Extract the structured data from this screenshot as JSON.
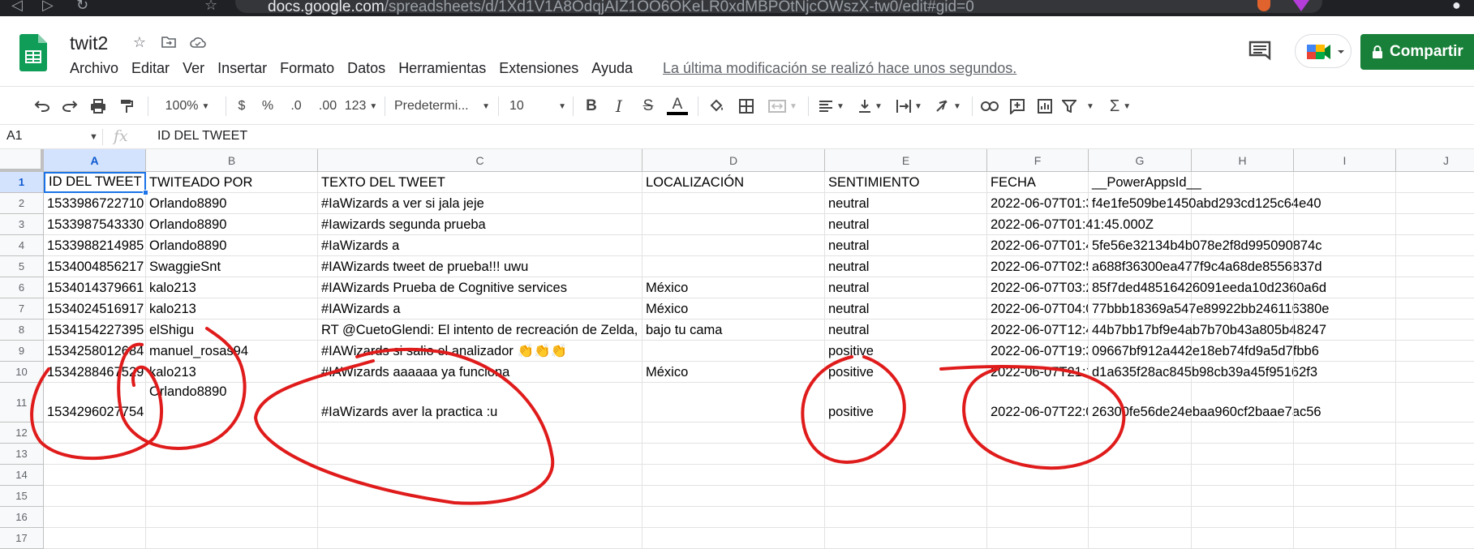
{
  "browser": {
    "url_host": "docs.google.com",
    "url_path": "/spreadsheets/d/1Xd1V1A8OdqjAIZ1OO6OKeLR0xdMBPOtNjcOWszX-tw0/edit#gid=0"
  },
  "doc": {
    "title": "twit2",
    "last_modified": "La última modificación se realizó hace unos segundos."
  },
  "menu": [
    "Archivo",
    "Editar",
    "Ver",
    "Insertar",
    "Formato",
    "Datos",
    "Herramientas",
    "Extensiones",
    "Ayuda"
  ],
  "share_label": "Compartir",
  "toolbar": {
    "zoom": "100%",
    "currency": "$",
    "percent": "%",
    "dec_decrease": ".0",
    "dec_increase": ".00",
    "more_formats": "123",
    "font": "Predetermi...",
    "font_size": "10",
    "bold": "B",
    "italic": "I",
    "strike": "S",
    "text_color": "A"
  },
  "formula_bar": {
    "cell_ref": "A1",
    "fx": "fx",
    "value": "ID DEL TWEET"
  },
  "columns": [
    "A",
    "B",
    "C",
    "D",
    "E",
    "F",
    "G",
    "H",
    "I",
    "J"
  ],
  "rows": [
    "1",
    "2",
    "3",
    "4",
    "5",
    "6",
    "7",
    "8",
    "9",
    "10",
    "11",
    "12",
    "13",
    "14",
    "15",
    "16",
    "17"
  ],
  "cells": [
    [
      "ID DEL TWEET",
      "TWITEADO POR",
      "TEXTO DEL TWEET",
      "LOCALIZACIÓN",
      "SENTIMIENTO",
      "FECHA",
      "__PowerAppsId__"
    ],
    [
      "1533986722710",
      "Orlando8890",
      "#IaWizards a ver si jala jeje",
      "",
      "neutral",
      "2022-06-07T01:3",
      "f4e1fe509be1450abd293cd125c64e40"
    ],
    [
      "1533987543330",
      "Orlando8890",
      "#Iawizards segunda prueba",
      "",
      "neutral",
      "2022-06-07T01:41:45.000Z",
      ""
    ],
    [
      "1533988214985",
      "Orlando8890",
      "#IaWizards a",
      "",
      "neutral",
      "2022-06-07T01:4",
      "5fe56e32134b4b078e2f8d995090874c"
    ],
    [
      "1534004856217",
      "SwaggieSnt",
      "#IAWizards tweet de prueba!!! uwu",
      "",
      "neutral",
      "2022-06-07T02:5",
      "a688f36300ea477f9c4a68de8556837d"
    ],
    [
      "1534014379661",
      "kalo213",
      "#IAWizards Prueba de Cognitive services",
      "México",
      "neutral",
      "2022-06-07T03:2",
      "85f7ded48516426091eeda10d2360a6d"
    ],
    [
      "1534024516917",
      "kalo213",
      "#IAWizards a",
      "México",
      "neutral",
      "2022-06-07T04:0",
      "77bbb18369a547e89922bb246116380e"
    ],
    [
      "1534154227395",
      "elShigu",
      "RT @CuetoGlendi: El intento de recreación de Zelda,",
      "bajo tu cama",
      "neutral",
      "2022-06-07T12:4",
      "44b7bb17bf9e4ab7b70b43a805b48247"
    ],
    [
      "1534258012684",
      "manuel_rosas94",
      "#IAWizards si salio el analizador 👏👏👏",
      "",
      "positive",
      "2022-06-07T19:3",
      "09667bf912a442e18eb74fd9a5d7fbb6"
    ],
    [
      "1534288467529",
      "kalo213",
      "#IAWizards aaaaaa ya funciona",
      "México",
      "positive",
      "2022-06-07T21:1",
      "d1a635f28ac845b98cb39a45f95162f3"
    ],
    [
      "1534296027754",
      "Orlando8890",
      "#IaWizards aver la practica :u",
      "",
      "positive",
      "2022-06-07T22:0",
      "26300fe56de24ebaa960cf2baae7ac56"
    ]
  ],
  "colors": {
    "share_green": "#188038",
    "selection_blue": "#1a73e8",
    "annotation_red": "#e01b1b"
  }
}
